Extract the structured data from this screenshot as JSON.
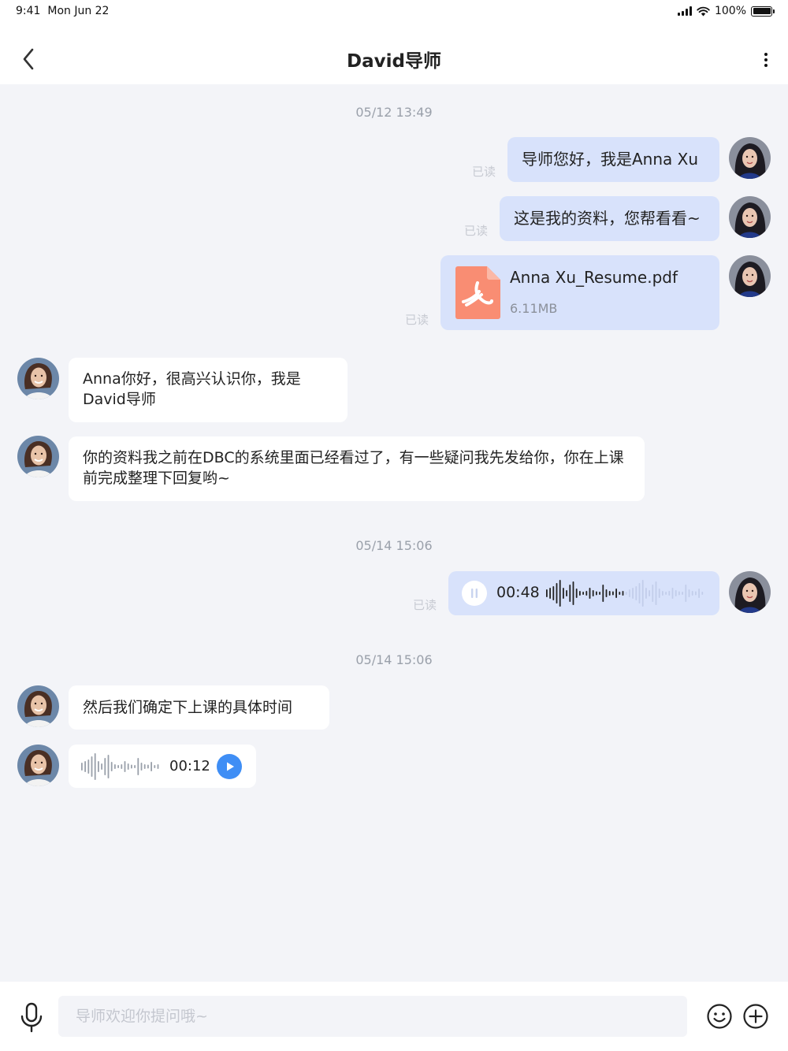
{
  "status_bar": {
    "time": "9:41",
    "date": "Mon Jun 22",
    "battery": "100%"
  },
  "header": {
    "title": "David导师",
    "back_icon": "chevron-left-icon",
    "more_icon": "more-vertical-icon"
  },
  "messages": {
    "ts1": "05/12 13:49",
    "m1": {
      "text": "导师您好，我是Anna Xu",
      "status": "已读"
    },
    "m2": {
      "text": "这是我的资料，您帮看看~",
      "status": "已读"
    },
    "m3": {
      "file_name": "Anna Xu_Resume.pdf",
      "file_size": "6.11MB",
      "status": "已读",
      "file_icon": "pdf-file-icon",
      "file_color": "#f98d73"
    },
    "m4": {
      "text": "Anna你好，很高兴认识你，我是David导师"
    },
    "m5": {
      "text": "你的资料我之前在DBC的系统里面已经看过了，有一些疑问我先发给你，你在上课前完成整理下回复哟~"
    },
    "ts2": "05/14 15:06",
    "m6": {
      "duration": "00:48",
      "status": "已读",
      "state": "playing",
      "progress": 0.5
    },
    "ts3": "05/14 15:06",
    "m7": {
      "text": "然后我们确定下上课的具体时间"
    },
    "m8": {
      "duration": "00:12",
      "state": "paused"
    }
  },
  "composer": {
    "placeholder": "导师欢迎你提问哦~",
    "mic_icon": "microphone-icon",
    "emoji_icon": "emoji-icon",
    "plus_icon": "plus-circle-icon"
  },
  "colors": {
    "accent": "#3f8ef5",
    "bubble_me": "#d8e2fb",
    "bubble_other": "#ffffff",
    "background": "#f3f4f8"
  }
}
